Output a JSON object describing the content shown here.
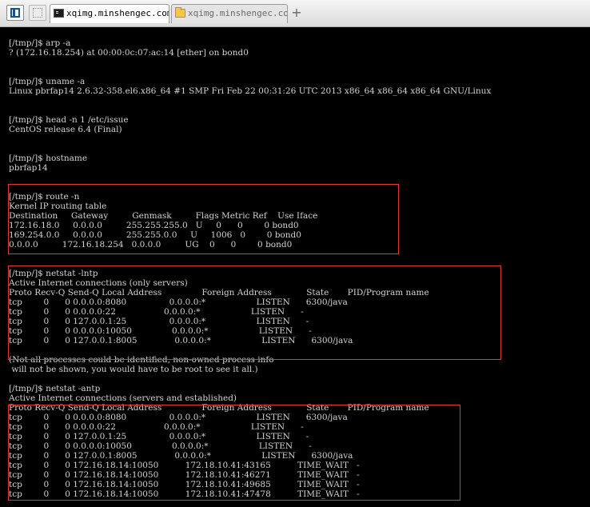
{
  "tabs": [
    {
      "label": "xqimg.minshengec.com",
      "icon": "terminal-icon",
      "active": true
    },
    {
      "label": "xqimg.minshengec.com",
      "icon": "folder-icon",
      "active": false
    }
  ],
  "new_tab_label": "+",
  "terminal": {
    "lines": [
      "[/tmp/]$ arp -a",
      "? (172.16.18.254) at 00:00:0c:07:ac:14 [ether] on bond0",
      "",
      "",
      "[/tmp/]$ uname -a",
      "Linux pbrfap14 2.6.32-358.el6.x86_64 #1 SMP Fri Feb 22 00:31:26 UTC 2013 x86_64 x86_64 x86_64 GNU/Linux",
      "",
      "",
      "[/tmp/]$ head -n 1 /etc/issue",
      "CentOS release 6.4 (Final)",
      "",
      "",
      "[/tmp/]$ hostname",
      "pbrfap14",
      "",
      "",
      "[/tmp/]$ route -n",
      "Kernel IP routing table",
      "Destination     Gateway         Genmask         Flags Metric Ref    Use Iface",
      "172.16.18.0     0.0.0.0         255.255.255.0   U     0      0        0 bond0",
      "169.254.0.0     0.0.0.0         255.255.0.0     U     1006   0        0 bond0",
      "0.0.0.0         172.16.18.254   0.0.0.0         UG    0      0        0 bond0",
      "",
      "",
      "[/tmp/]$ netstat -lntp",
      "Active Internet connections (only servers)",
      "Proto Recv-Q Send-Q Local Address               Foreign Address             State       PID/Program name",
      "tcp        0      0 0.0.0.0:8080                0.0.0.0:*                   LISTEN      6300/java",
      "tcp        0      0 0.0.0.0:22                  0.0.0.0:*                   LISTEN      -",
      "tcp        0      0 127.0.0.1:25                0.0.0.0:*                   LISTEN      -",
      "tcp        0      0 0.0.0.0:10050               0.0.0.0:*                   LISTEN      -",
      "tcp        0      0 127.0.0.1:8005              0.0.0.0:*                   LISTEN      6300/java",
      "",
      "(Not all processes could be identified, non-owned process info",
      " will not be shown, you would have to be root to see it all.)",
      "",
      "[/tmp/]$ netstat -antp",
      "Active Internet connections (servers and established)",
      "Proto Recv-Q Send-Q Local Address               Foreign Address             State       PID/Program name",
      "tcp        0      0 0.0.0.0:8080                0.0.0.0:*                   LISTEN      6300/java",
      "tcp        0      0 0.0.0.0:22                  0.0.0.0:*                   LISTEN      -",
      "tcp        0      0 127.0.0.1:25                0.0.0.0:*                   LISTEN      -",
      "tcp        0      0 0.0.0.0:10050               0.0.0.0:*                   LISTEN      -",
      "tcp        0      0 127.0.0.1:8005              0.0.0.0:*                   LISTEN      6300/java",
      "tcp        0      0 172.16.18.14:10050          172.18.10.41:43165          TIME_WAIT   -",
      "tcp        0      0 172.16.18.14:10050          172.18.10.41:46271          TIME_WAIT   -",
      "tcp        0      0 172.16.18.14:10050          172.18.10.41:49685          TIME_WAIT   -",
      "tcp        0      0 172.16.18.14:10050          172.18.10.41:47478          TIME_WAIT   -"
    ]
  },
  "colors": {
    "terminal_bg": "#000000",
    "terminal_text": "#d4d4d4",
    "highlight_border": "#e03a3a"
  }
}
